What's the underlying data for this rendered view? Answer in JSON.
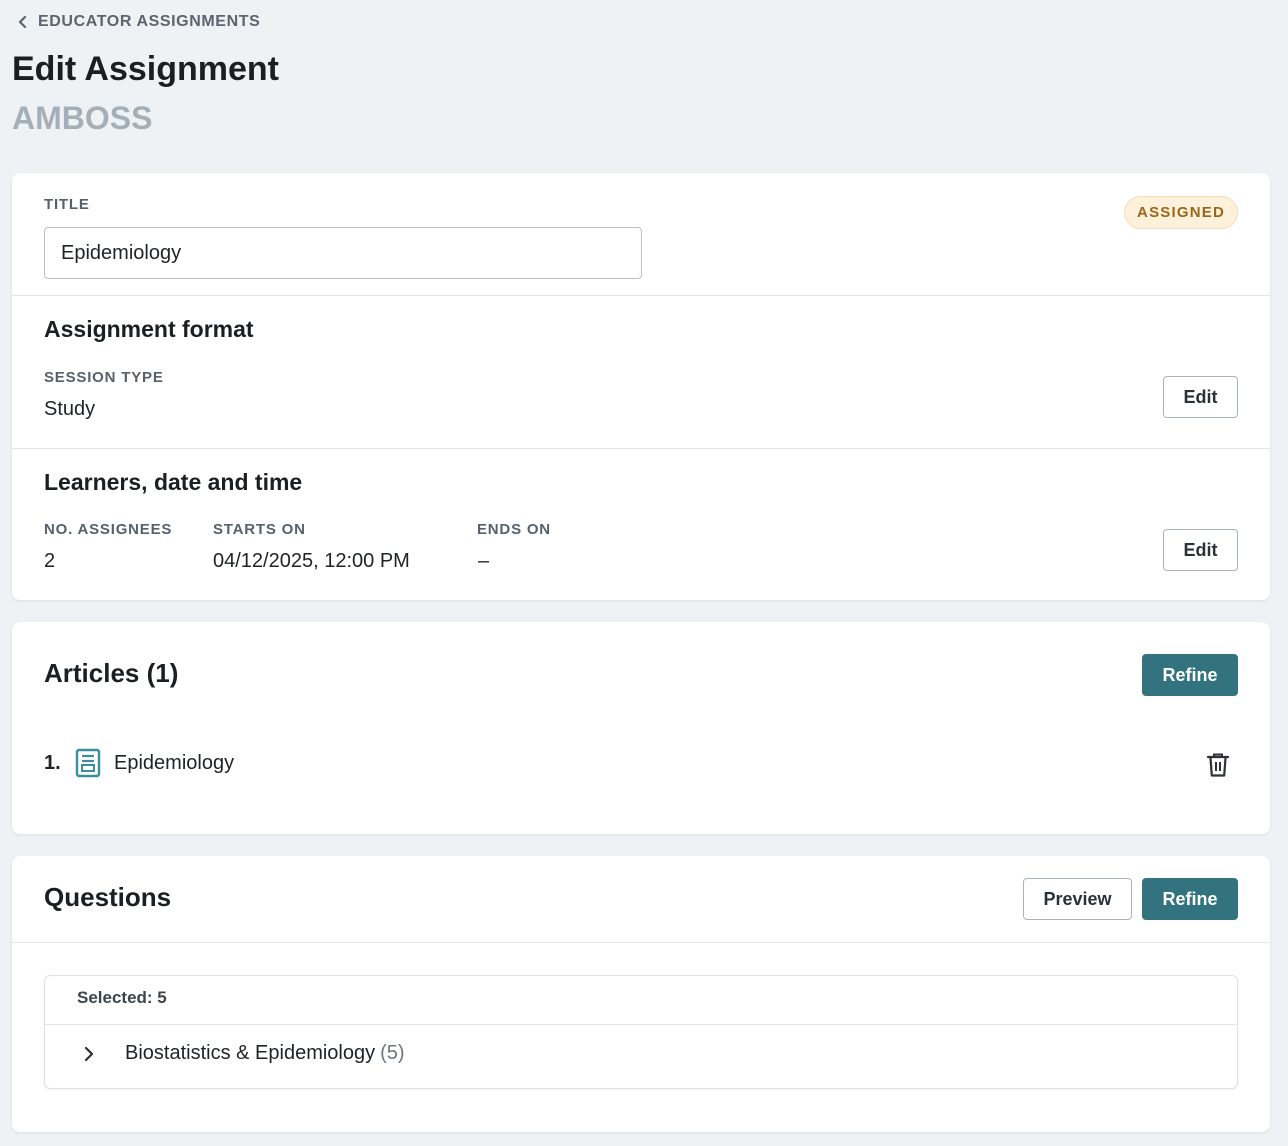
{
  "breadcrumb": {
    "label": "EDUCATOR ASSIGNMENTS"
  },
  "page": {
    "title": "Edit Assignment",
    "subtitle": "AMBOSS"
  },
  "details": {
    "title_label": "TITLE",
    "title_value": "Epidemiology",
    "status": "ASSIGNED",
    "format": {
      "heading": "Assignment format",
      "session_type_label": "SESSION TYPE",
      "session_type_value": "Study",
      "edit_label": "Edit"
    },
    "schedule": {
      "heading": "Learners, date and time",
      "assignees_label": "NO. ASSIGNEES",
      "assignees_value": "2",
      "starts_label": "STARTS ON",
      "starts_value": "04/12/2025, 12:00 PM",
      "ends_label": "ENDS ON",
      "ends_value": "–",
      "edit_label": "Edit"
    }
  },
  "articles": {
    "heading": "Articles (1)",
    "refine_label": "Refine",
    "items": [
      {
        "number": "1.",
        "title": "Epidemiology",
        "icon": "article-icon"
      }
    ]
  },
  "questions": {
    "heading": "Questions",
    "preview_label": "Preview",
    "refine_label": "Refine",
    "selected_label": "Selected: 5",
    "topics": [
      {
        "name": "Biostatistics & Epidemiology",
        "count": "(5)"
      }
    ]
  },
  "colors": {
    "background": "#eef2f5",
    "primary": "#33737f",
    "badge_bg": "#fdf1dc",
    "badge_text": "#9a6718",
    "icon_teal": "#3a8f9c"
  }
}
